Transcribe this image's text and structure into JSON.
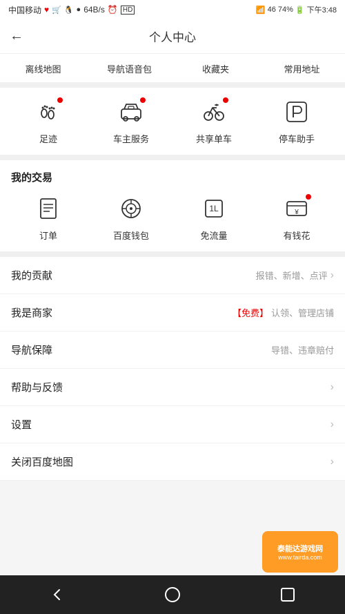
{
  "statusBar": {
    "carrier": "中国移动",
    "signal": "46",
    "battery": "74%",
    "time": "下午3:48",
    "speed": "64B/s"
  },
  "header": {
    "back_icon": "←",
    "title": "个人中心"
  },
  "quickNav": {
    "items": [
      {
        "label": "离线地图"
      },
      {
        "label": "导航语音包"
      },
      {
        "label": "收藏夹"
      },
      {
        "label": "常用地址"
      }
    ]
  },
  "iconGrid": {
    "items": [
      {
        "label": "足迹",
        "icon": "footprint",
        "dot": true
      },
      {
        "label": "车主服务",
        "icon": "car",
        "dot": true
      },
      {
        "label": "共享单车",
        "icon": "bike",
        "dot": true
      },
      {
        "label": "停车助手",
        "icon": "parking",
        "dot": false
      }
    ]
  },
  "transactionSection": {
    "title": "我的交易",
    "items": [
      {
        "label": "订单",
        "icon": "order",
        "dot": false
      },
      {
        "label": "百度钱包",
        "icon": "wallet",
        "dot": false
      },
      {
        "label": "免流量",
        "icon": "flow",
        "dot": false
      },
      {
        "label": "有钱花",
        "icon": "money",
        "dot": true
      }
    ]
  },
  "listItems": [
    {
      "label": "我的贡献",
      "right_text": "报错、新增、点评",
      "has_chevron": true,
      "highlight": false
    },
    {
      "label": "我是商家",
      "right_prefix": "【免费】",
      "right_text": "认领、管理店铺",
      "has_chevron": false,
      "highlight": true
    },
    {
      "label": "导航保障",
      "right_text": "导错、违章赔付",
      "has_chevron": false,
      "highlight": false
    },
    {
      "label": "帮助与反馈",
      "right_text": "",
      "has_chevron": true,
      "highlight": false
    },
    {
      "label": "设置",
      "right_text": "",
      "has_chevron": true,
      "highlight": false
    },
    {
      "label": "关闭百度地图",
      "right_text": "",
      "has_chevron": true,
      "highlight": false
    }
  ],
  "bottomNav": {
    "back": "‹",
    "home": "○",
    "recent": "□"
  },
  "watermark": {
    "line1": "泰能达游戏网",
    "line2": "www.tairda.com"
  },
  "colors": {
    "accent": "#e00000",
    "background": "#f5f5f5",
    "text_primary": "#222",
    "text_secondary": "#999"
  }
}
